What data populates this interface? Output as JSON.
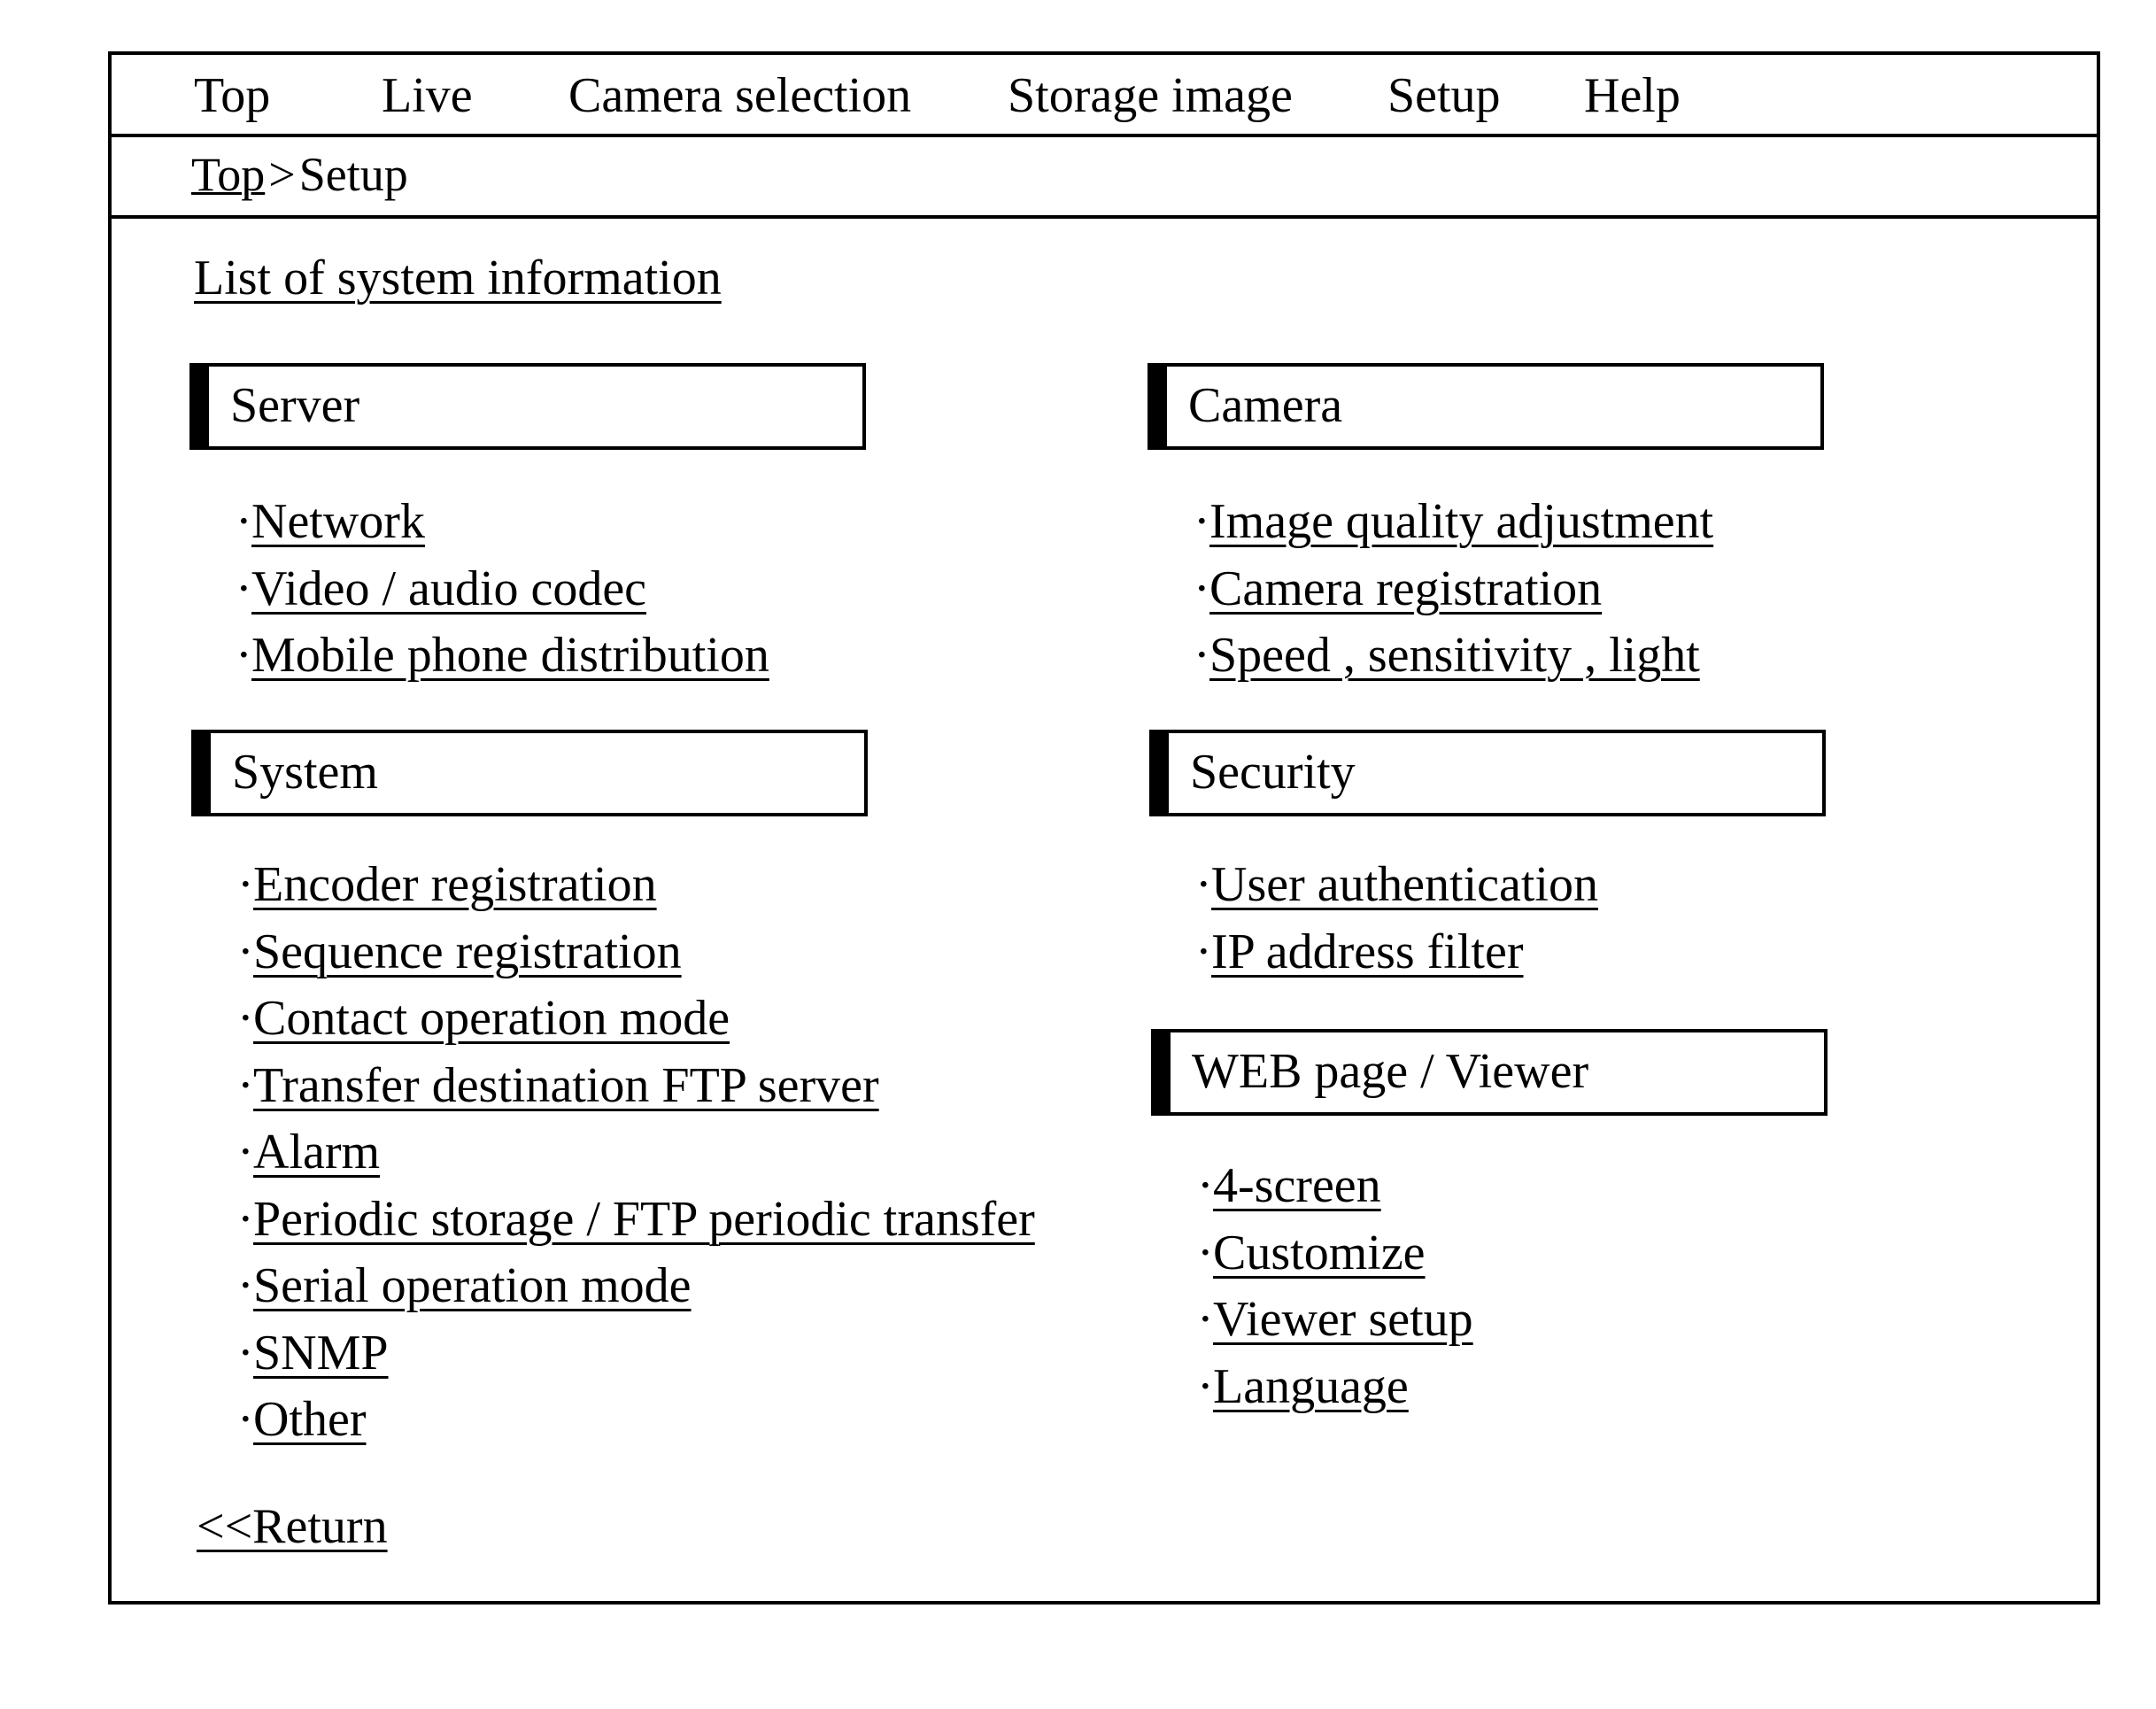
{
  "menu": {
    "items": [
      {
        "label": "Top"
      },
      {
        "label": "Live"
      },
      {
        "label": "Camera selection"
      },
      {
        "label": "Storage image"
      },
      {
        "label": "Setup"
      },
      {
        "label": "Help"
      }
    ]
  },
  "breadcrumb": {
    "home": "Top",
    "separator": ">",
    "current": "Setup"
  },
  "main": {
    "title": "List of system information",
    "bullet": "·",
    "sections": {
      "server": {
        "title": "Server",
        "items": [
          "Network",
          "Video / audio codec",
          "Mobile phone distribution"
        ]
      },
      "system": {
        "title": "System",
        "items": [
          "Encoder registration",
          "Sequence registration",
          "Contact operation mode",
          "Transfer destination FTP server",
          "Alarm",
          "Periodic storage / FTP periodic transfer",
          "Serial operation mode",
          "SNMP",
          "Other"
        ]
      },
      "camera": {
        "title": "Camera",
        "items": [
          "Image quality adjustment",
          "Camera registration",
          "Speed , sensitivity , light"
        ]
      },
      "security": {
        "title": "Security",
        "items": [
          "User authentication",
          "IP address filter"
        ]
      },
      "web": {
        "title": "WEB page / Viewer",
        "items": [
          "4-screen",
          "Customize",
          "Viewer setup",
          "Language"
        ]
      }
    },
    "return_label": "<<Return"
  }
}
